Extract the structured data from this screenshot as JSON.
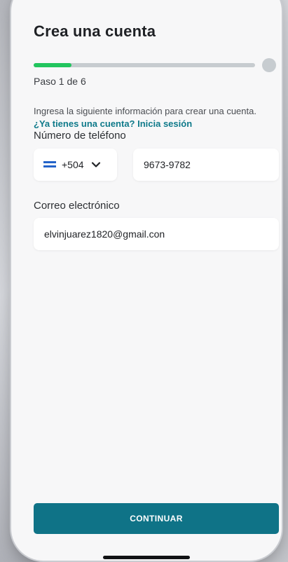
{
  "header": {
    "title": "Crea una cuenta"
  },
  "progress": {
    "current_step": 1,
    "total_steps": 6,
    "fraction": 0.17,
    "label": "Paso 1 de 6",
    "fill_color": "#22c55e",
    "track_color": "#c7ccd0"
  },
  "intro": {
    "text": "Ingresa la siguiente información para crear una cuenta.",
    "login_link": "¿Ya tienes una cuenta? Inicia sesión"
  },
  "phone": {
    "label": "Número de teléfono",
    "country_flag_icon": "honduras-flag-icon",
    "country_code": "+504",
    "dropdown_icon": "chevron-down-icon",
    "number": "9673-9782"
  },
  "email": {
    "label": "Correo electrónico",
    "value": "elvinjuarez1820@gmail.con"
  },
  "actions": {
    "continue_label": "CONTINUAR",
    "button_color": "#0f7387"
  }
}
